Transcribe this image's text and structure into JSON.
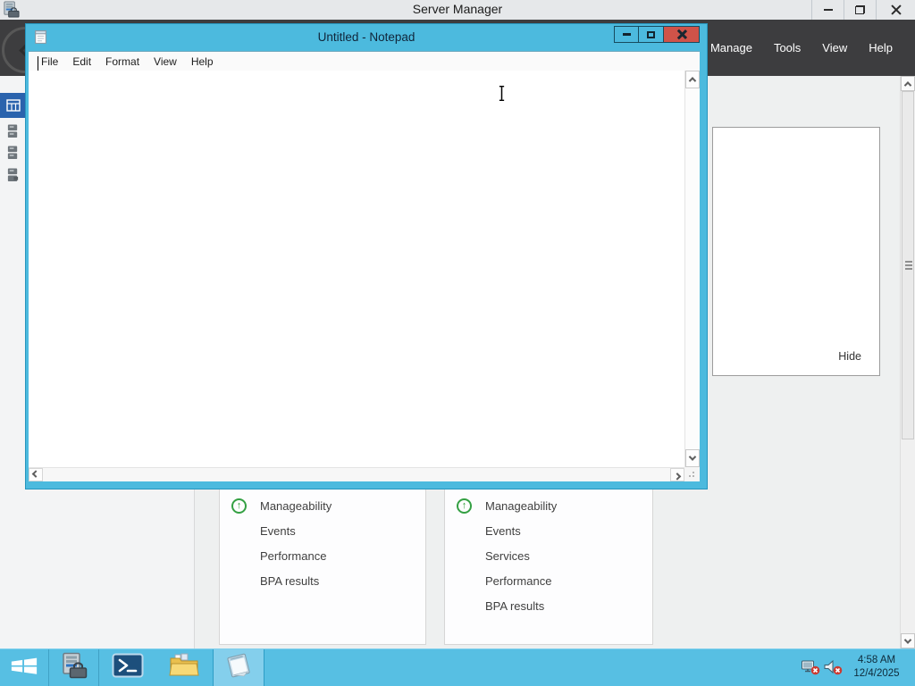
{
  "server_manager": {
    "title": "Server Manager",
    "menu": {
      "manage": "Manage",
      "tools": "Tools",
      "view": "View",
      "help": "Help"
    },
    "flyout": {
      "hide": "Hide"
    },
    "tiles": [
      {
        "items": [
          "Manageability",
          "Events",
          "Performance",
          "BPA results"
        ]
      },
      {
        "items": [
          "Manageability",
          "Events",
          "Services",
          "Performance",
          "BPA results"
        ]
      }
    ]
  },
  "notepad": {
    "title": "Untitled - Notepad",
    "menu": [
      "File",
      "Edit",
      "Format",
      "View",
      "Help"
    ],
    "text": ""
  },
  "taskbar": {
    "clock": {
      "time": "4:58 AM",
      "date": "12/4/2025"
    }
  },
  "icons": {
    "accent_colors": {
      "taskbar_cyan": "#57bfe3",
      "notepad_frame": "#4cbade",
      "close_red": "#cf5349",
      "nav_selected_blue": "#2a63ad",
      "status_green": "#34a043",
      "menubar_dark": "#3d3d3f"
    },
    "names": [
      "server-manager-icon",
      "back-arrow-icon",
      "dashboard-grid-icon",
      "server-icon",
      "up-arrow-status-icon",
      "notepad-icon",
      "start-icon",
      "powershell-icon",
      "file-explorer-icon",
      "network-disconnected-icon",
      "volume-muted-icon",
      "minimize-icon",
      "restore-icon",
      "maximize-icon",
      "close-icon",
      "scroll-up-icon",
      "scroll-down-icon",
      "scroll-left-icon",
      "scroll-right-icon",
      "resize-grip-icon",
      "i-beam-cursor-icon"
    ]
  }
}
